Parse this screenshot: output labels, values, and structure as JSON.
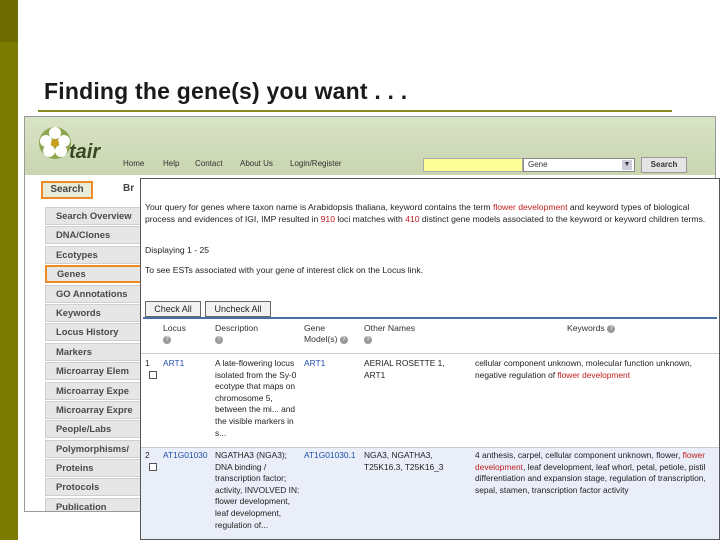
{
  "slide": {
    "title": "Finding the gene(s) you want . . ."
  },
  "tair": {
    "logo_text": "tair",
    "nav": [
      "Home",
      "Help",
      "Contact",
      "About Us",
      "Login/Register"
    ],
    "search_select": "Gene",
    "search_button": "Search",
    "tab_search": "Search",
    "tab_browse": "Br",
    "sidebar": [
      {
        "label": "Search Overview"
      },
      {
        "label": "DNA/Clones"
      },
      {
        "label": "Ecotypes"
      },
      {
        "label": "Genes"
      },
      {
        "label": "GO Annotations"
      },
      {
        "label": "Keywords"
      },
      {
        "label": "Locus History"
      },
      {
        "label": "Markers"
      },
      {
        "label": "Microarray Elem"
      },
      {
        "label": "Microarray Expe"
      },
      {
        "label": "Microarray Expre"
      },
      {
        "label": "People/Labs"
      },
      {
        "label": "Polymorphisms/"
      },
      {
        "label": "Proteins"
      },
      {
        "label": "Protocols"
      },
      {
        "label": "Publication"
      }
    ],
    "accent_color": "#f08a24"
  },
  "results": {
    "query_pre": "Your query for genes where taxon name is Arabidopsis thaliana, keyword contains the term ",
    "query_term": "flower development",
    "query_mid": " and keyword types of biological process and evidences of IGI, IMP resulted in ",
    "query_count": "910",
    "query_mid2": " loci matches with ",
    "query_models": "410",
    "query_post": " distinct gene models associated to the keyword or keyword children terms.",
    "displaying": "Displaying 1 - 25",
    "ests_note": "To see ESTs associated with your gene of interest click on the Locus link.",
    "check_all": "Check All",
    "uncheck_all": "Uncheck All",
    "columns": {
      "locus": "Locus",
      "description": "Description",
      "gene_model": "Gene Model(s)",
      "other_names": "Other Names",
      "keywords": "Keywords"
    },
    "rows": [
      {
        "num": "1",
        "locus": "ART1",
        "description": "A late-flowering locus isolated from the Sy-0 ecotype that maps on chromosome 5, between the mi... and the visible markers in s...",
        "gene_model": "ART1",
        "other_names": "AERIAL ROSETTE 1, ART1",
        "kw_pre": "cellular component unknown, molecular function unknown, negative regulation of ",
        "kw_red": "flower development",
        "kw_post": ""
      },
      {
        "num": "2",
        "locus": "AT1G01030",
        "description": "NGATHA3 (NGA3); DNA binding / transcription factor; activity, INVOLVED IN: flower development, leaf development, regulation of...",
        "gene_model": "AT1G01030.1",
        "other_names": "NGA3, NGATHA3, T25K16.3, T25K16_3",
        "kw_pre": "4 anthesis, carpel, cellular component unknown, flower, ",
        "kw_red": "flower development",
        "kw_post": ", leaf development, leaf whorl, petal, petiole, pistil differentiation and expansion stage, regulation of transcription, sepal, stamen, transcription factor activity"
      }
    ],
    "link_color": "#1f4fa8",
    "highlight_color": "#c02020"
  }
}
